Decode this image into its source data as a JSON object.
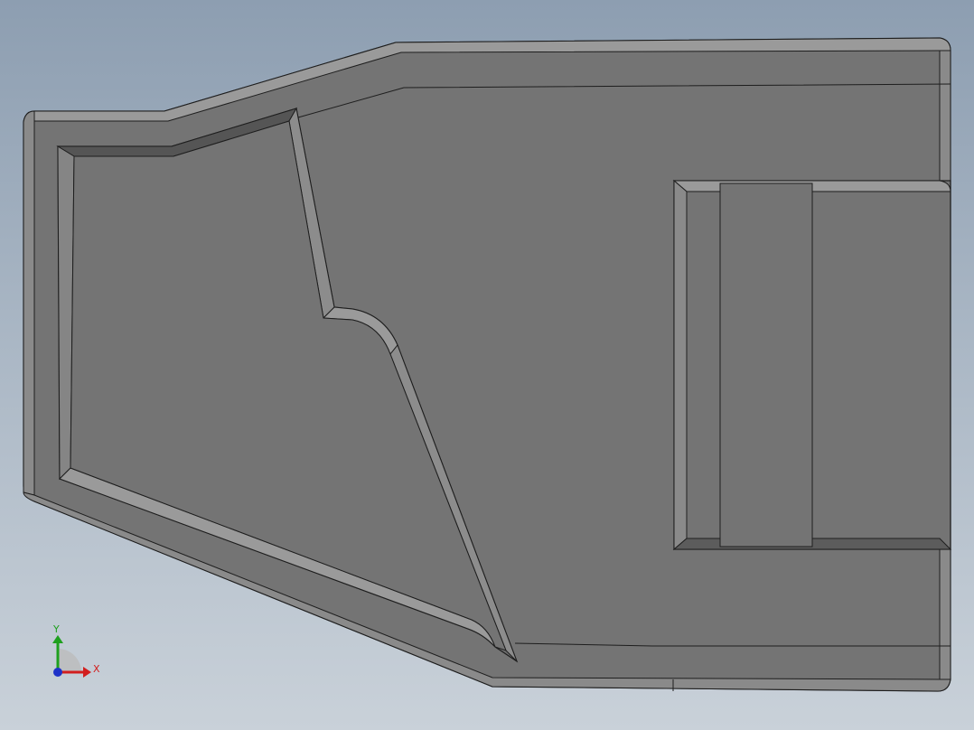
{
  "viewport": {
    "background_top": "#8d9eb1",
    "background_bottom": "#c9d1d9"
  },
  "model": {
    "face_color": "#747474",
    "edge_color": "#1e1e1e",
    "bevel_color": "#9a9a9a",
    "shadow_color": "#5c5c5c"
  },
  "triad": {
    "x_label": "X",
    "y_label": "Y",
    "x_color": "#d21e1e",
    "y_color": "#1ea01e",
    "z_color": "#1e32c8"
  }
}
